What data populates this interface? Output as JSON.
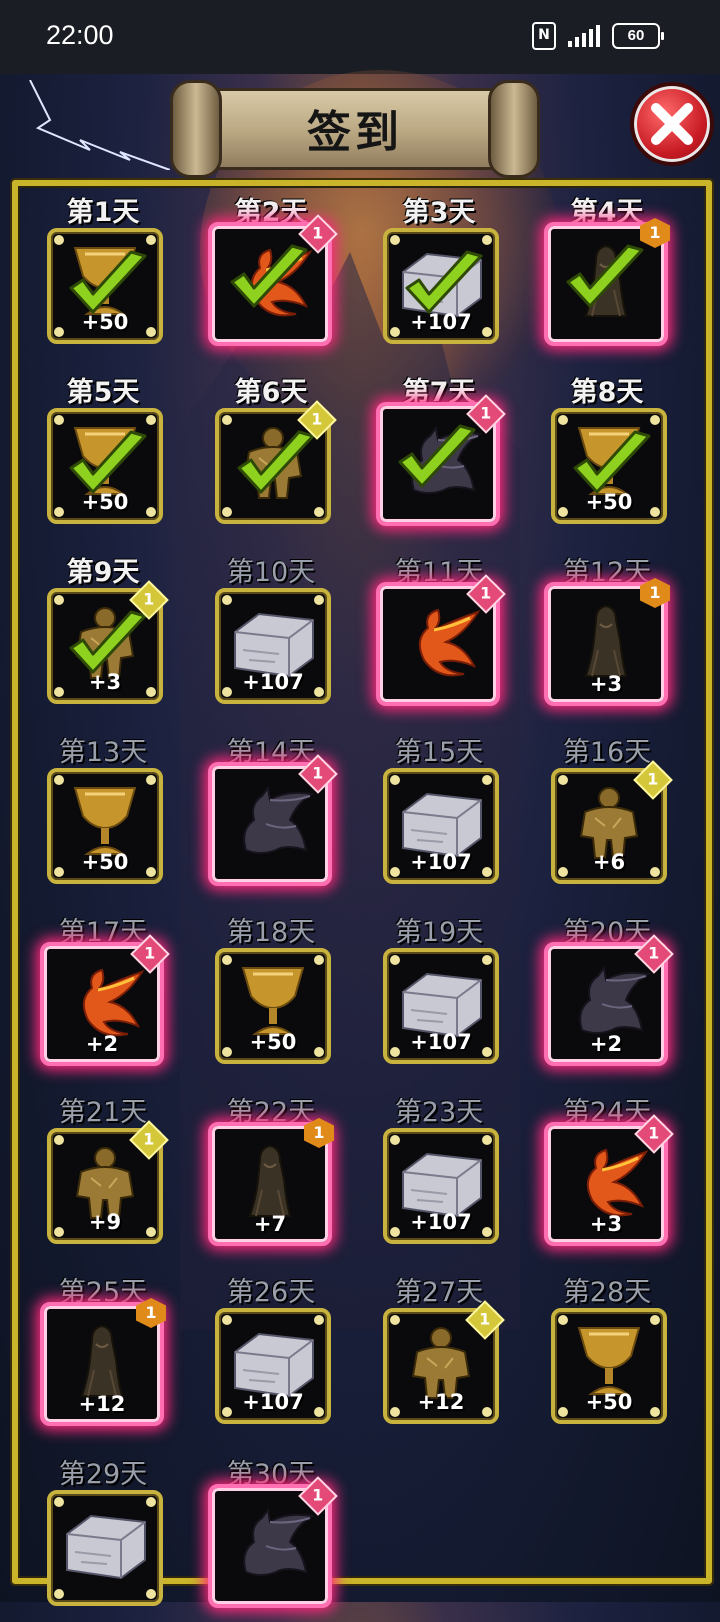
{
  "status_bar": {
    "time": "22:00",
    "nfc": "N",
    "battery": "60"
  },
  "header": {
    "title": "签到"
  },
  "days": [
    {
      "label": "第1天",
      "item": "goblet",
      "rarity": "common",
      "amount": "+50",
      "claimed": true,
      "badge": ""
    },
    {
      "label": "第2天",
      "item": "phoenix",
      "rarity": "rare",
      "amount": "",
      "claimed": true,
      "badge": "pink"
    },
    {
      "label": "第3天",
      "item": "stone",
      "rarity": "common",
      "amount": "+107",
      "claimed": true,
      "badge": ""
    },
    {
      "label": "第4天",
      "item": "wraith",
      "rarity": "rare",
      "amount": "",
      "claimed": true,
      "badge": "orange"
    },
    {
      "label": "第5天",
      "item": "goblet",
      "rarity": "common",
      "amount": "+50",
      "claimed": true,
      "badge": ""
    },
    {
      "label": "第6天",
      "item": "golem",
      "rarity": "common",
      "amount": "",
      "claimed": true,
      "badge": "yellow"
    },
    {
      "label": "第7天",
      "item": "dragon",
      "rarity": "rare",
      "amount": "",
      "claimed": true,
      "badge": "pink"
    },
    {
      "label": "第8天",
      "item": "goblet",
      "rarity": "common",
      "amount": "+50",
      "claimed": true,
      "badge": ""
    },
    {
      "label": "第9天",
      "item": "golem",
      "rarity": "common",
      "amount": "+3",
      "claimed": true,
      "badge": "yellow"
    },
    {
      "label": "第10天",
      "item": "stone",
      "rarity": "common",
      "amount": "+107",
      "claimed": false,
      "badge": ""
    },
    {
      "label": "第11天",
      "item": "phoenix",
      "rarity": "rare",
      "amount": "",
      "claimed": false,
      "badge": "pink"
    },
    {
      "label": "第12天",
      "item": "wraith",
      "rarity": "rare",
      "amount": "+3",
      "claimed": false,
      "badge": "orange"
    },
    {
      "label": "第13天",
      "item": "goblet",
      "rarity": "common",
      "amount": "+50",
      "claimed": false,
      "badge": ""
    },
    {
      "label": "第14天",
      "item": "dragon",
      "rarity": "rare",
      "amount": "",
      "claimed": false,
      "badge": "pink"
    },
    {
      "label": "第15天",
      "item": "stone",
      "rarity": "common",
      "amount": "+107",
      "claimed": false,
      "badge": ""
    },
    {
      "label": "第16天",
      "item": "golem",
      "rarity": "common",
      "amount": "+6",
      "claimed": false,
      "badge": "yellow"
    },
    {
      "label": "第17天",
      "item": "phoenix",
      "rarity": "rare",
      "amount": "+2",
      "claimed": false,
      "badge": "pink"
    },
    {
      "label": "第18天",
      "item": "goblet",
      "rarity": "common",
      "amount": "+50",
      "claimed": false,
      "badge": ""
    },
    {
      "label": "第19天",
      "item": "stone",
      "rarity": "common",
      "amount": "+107",
      "claimed": false,
      "badge": ""
    },
    {
      "label": "第20天",
      "item": "dragon",
      "rarity": "rare",
      "amount": "+2",
      "claimed": false,
      "badge": "pink"
    },
    {
      "label": "第21天",
      "item": "golem",
      "rarity": "common",
      "amount": "+9",
      "claimed": false,
      "badge": "yellow"
    },
    {
      "label": "第22天",
      "item": "wraith",
      "rarity": "rare",
      "amount": "+7",
      "claimed": false,
      "badge": "orange"
    },
    {
      "label": "第23天",
      "item": "stone",
      "rarity": "common",
      "amount": "+107",
      "claimed": false,
      "badge": ""
    },
    {
      "label": "第24天",
      "item": "phoenix",
      "rarity": "rare",
      "amount": "+3",
      "claimed": false,
      "badge": "pink"
    },
    {
      "label": "第25天",
      "item": "wraith",
      "rarity": "rare",
      "amount": "+12",
      "claimed": false,
      "badge": "orange"
    },
    {
      "label": "第26天",
      "item": "stone",
      "rarity": "common",
      "amount": "+107",
      "claimed": false,
      "badge": ""
    },
    {
      "label": "第27天",
      "item": "golem",
      "rarity": "common",
      "amount": "+12",
      "claimed": false,
      "badge": "yellow"
    },
    {
      "label": "第28天",
      "item": "goblet",
      "rarity": "common",
      "amount": "+50",
      "claimed": false,
      "badge": ""
    },
    {
      "label": "第29天",
      "item": "stone",
      "rarity": "common",
      "amount": "",
      "claimed": false,
      "badge": ""
    },
    {
      "label": "第30天",
      "item": "dragon",
      "rarity": "rare",
      "amount": "",
      "claimed": false,
      "badge": "pink"
    }
  ],
  "badge_text": "1",
  "colors": {
    "frame": "#c9b42a",
    "rare_glow": "#ff2a7e",
    "check": "#8fd11f"
  }
}
